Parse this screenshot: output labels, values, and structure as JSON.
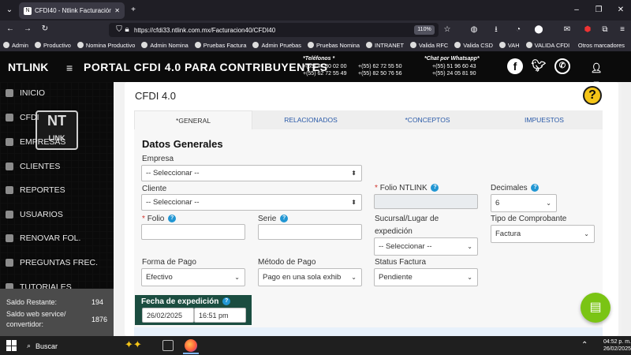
{
  "browser": {
    "tab_title": "CFDI40 - Ntlink Facturación",
    "tab_close": "✕",
    "new_tab": "+",
    "url": "https://cfdi33.ntlink.com.mx/Facturacion40/CFDI40",
    "zoom": "110%",
    "bookmarks": [
      "Admin",
      "Productivo",
      "Nomina Productivo",
      "Admin Nomina",
      "Pruebas Factura",
      "Admin Pruebas",
      "Pruebas Nomina",
      "INTRANET",
      "Valida RFC",
      "Valida CSD",
      "VAH",
      "VALIDA CFDI"
    ],
    "bookmarks_more": "Otros marcadores"
  },
  "site": {
    "brand": "NTLINK",
    "portal_title": "PORTAL CFDI 4.0 PARA CONTRIBUYENTES",
    "phones_label": "*Teléfonos *",
    "phones_col1": [
      "+(55) 47 80 02 00",
      "+(55) 62 72 55 49"
    ],
    "phones_col2": [
      "+(55) 62 72 55 50",
      "+(55) 82 50 76 56"
    ],
    "whatsapp_label": "*Chat por Whatsapp*",
    "whatsapp": [
      "+(55) 51 96 60 43",
      "+(55) 24 05 81 90"
    ]
  },
  "sidebar": {
    "logo_top": "NT",
    "logo_bottom": "LINK",
    "items": [
      {
        "label": "INICIO"
      },
      {
        "label": "CFDI"
      },
      {
        "label": "EMPRESAS"
      },
      {
        "label": "CLIENTES"
      },
      {
        "label": "REPORTES"
      },
      {
        "label": "USUARIOS"
      },
      {
        "label": "RENOVAR FOL."
      },
      {
        "label": "PREGUNTAS FREC."
      },
      {
        "label": "TUTORIALES"
      }
    ],
    "saldo_restante_label": "Saldo Restante:",
    "saldo_restante_value": "194",
    "saldo_ws_label_1": "Saldo web service/",
    "saldo_ws_label_2": "convertidor:",
    "saldo_ws_value": "1876"
  },
  "main": {
    "card_title": "CFDI 4.0",
    "help": "?",
    "tabs": [
      "*GENERAL",
      "RELACIONADOS",
      "*CONCEPTOS",
      "IMPUESTOS"
    ],
    "form_title": "Datos Generales",
    "empresa_label": "Empresa",
    "empresa_value": "-- Seleccionar --",
    "cliente_label": "Cliente",
    "cliente_value": "-- Seleccionar --",
    "folio_ntlink_label": "Folio NTLINK",
    "decimales_label": "Decimales",
    "decimales_value": "6",
    "folio_label": "Folio",
    "serie_label": "Serie",
    "sucursal_label_1": "Sucursal/Lugar de",
    "sucursal_label_2": "expedición",
    "sucursal_value": "-- Seleccionar --",
    "tipo_label": "Tipo de Comprobante",
    "tipo_value": "Factura",
    "forma_pago_label": "Forma de Pago",
    "forma_pago_value": "Efectivo",
    "metodo_pago_label": "Método de Pago",
    "metodo_pago_value": "Pago en una sola exhib",
    "status_label": "Status Factura",
    "status_value": "Pendiente",
    "fecha_label": "Fecha de expedición",
    "fecha_date": "26/02/2025",
    "fecha_time": "16:51 pm"
  },
  "taskbar": {
    "search_label": "Buscar",
    "time": "04:52 p. m.",
    "date": "26/02/2025"
  }
}
